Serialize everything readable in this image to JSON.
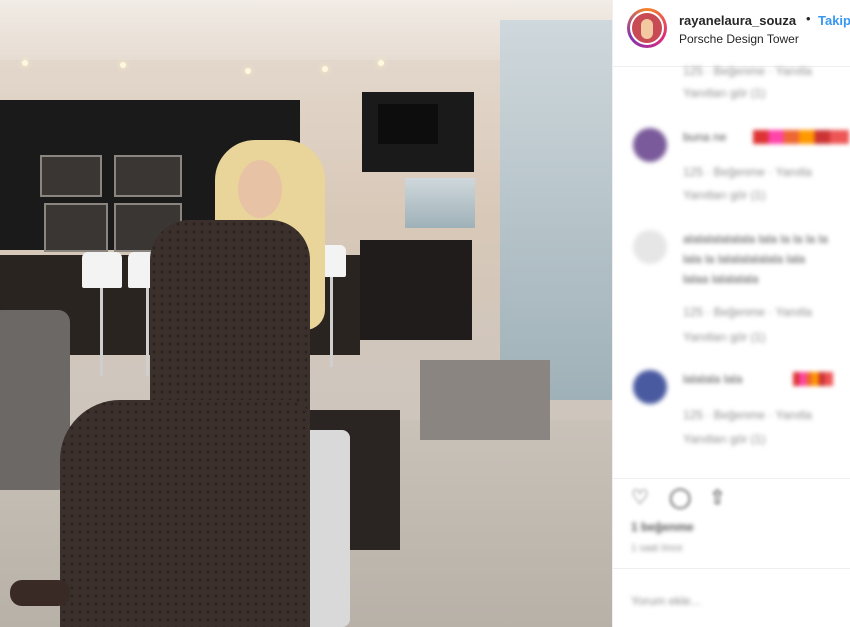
{
  "post": {
    "username": "rayanelaura_souza",
    "separator": "•",
    "follow_label": "Takip",
    "location": "Porsche Design Tower"
  },
  "comments": [
    {
      "text": "",
      "meta": "125 · Beğenme · Yanıtla",
      "sub": "Yanıtları gör (1)"
    },
    {
      "text": "buna ne",
      "meta": "125 · Beğenme · Yanıtla",
      "sub": "Yanıtları gör (1)"
    },
    {
      "text": "alalalalalalala lala la la la la",
      "line2": "lala la lalalalalalala lala",
      "line3": "lalaa lalalalala",
      "meta": "125 · Beğenme · Yanıtla",
      "sub": "Yanıtları gör (1)"
    },
    {
      "text": "lalalala lala",
      "meta": "125 · Beğenme · Yanıtla",
      "sub": "Yanıtları gör (1)"
    }
  ],
  "footer": {
    "likes": "1 beğenme",
    "time": "1 saat önce",
    "add_comment": "Yorum ekle..."
  },
  "icons": {
    "heart": "heart-icon",
    "comment": "comment-icon",
    "share": "share-icon"
  },
  "colors": {
    "follow": "#3897f0",
    "text": "#262626",
    "muted": "#8e8e8e"
  }
}
